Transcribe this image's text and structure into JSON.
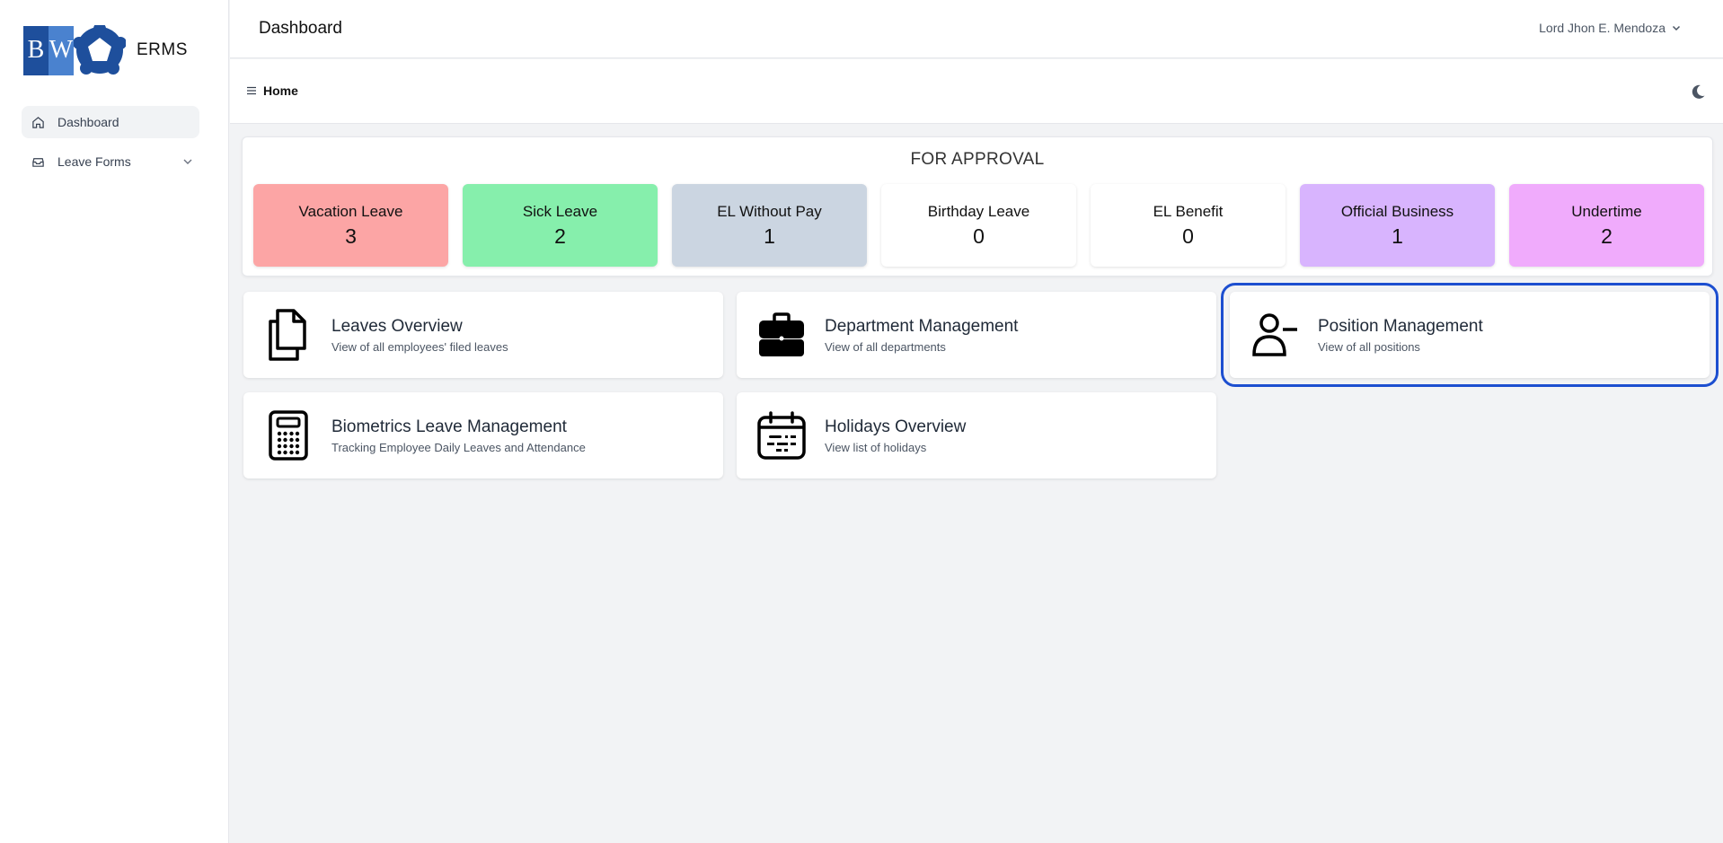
{
  "brand": {
    "logo_left": "B",
    "logo_right": "W",
    "name": "ERMS"
  },
  "sidebar": {
    "items": [
      {
        "label": "Dashboard",
        "icon": "home-icon",
        "active": true
      },
      {
        "label": "Leave Forms",
        "icon": "inbox-icon",
        "expandable": true
      }
    ]
  },
  "header": {
    "title": "Dashboard",
    "user_name": "Lord Jhon E. Mendoza"
  },
  "breadcrumb": {
    "label": "Home"
  },
  "approval": {
    "heading": "FOR APPROVAL",
    "tiles": [
      {
        "label": "Vacation Leave",
        "count": "3",
        "color": "#fca5a5"
      },
      {
        "label": "Sick Leave",
        "count": "2",
        "color": "#86efac"
      },
      {
        "label": "EL Without Pay",
        "count": "1",
        "color": "#cbd5e1"
      },
      {
        "label": "Birthday Leave",
        "count": "0",
        "color": "#ffffff"
      },
      {
        "label": "EL Benefit",
        "count": "0",
        "color": "#ffffff"
      },
      {
        "label": "Official Business",
        "count": "1",
        "color": "#d8b4fe"
      },
      {
        "label": "Undertime",
        "count": "2",
        "color": "#f0abfc"
      }
    ]
  },
  "cards": [
    {
      "title": "Leaves Overview",
      "subtitle": "View of all employees' filed leaves",
      "icon": "documents-icon"
    },
    {
      "title": "Department Management",
      "subtitle": "View of all departments",
      "icon": "briefcase-icon"
    },
    {
      "title": "Position Management",
      "subtitle": "View of all positions",
      "icon": "user-minus-icon",
      "selected": true
    },
    {
      "title": "Biometrics Leave Management",
      "subtitle": "Tracking Employee Daily Leaves and Attendance",
      "icon": "calculator-icon"
    },
    {
      "title": "Holidays Overview",
      "subtitle": "View list of holidays",
      "icon": "calendar-icon"
    }
  ],
  "colors": {
    "accent_outline": "#1d4fd0",
    "logo_dark": "#1e4f9c",
    "logo_light": "#4a82cf"
  }
}
